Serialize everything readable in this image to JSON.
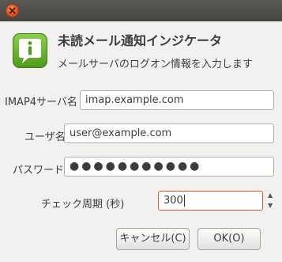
{
  "dialog": {
    "title": "未読メール通知インジケータ",
    "subtitle": "メールサーバのログオン情報を入力します"
  },
  "form": {
    "imap_server": {
      "label": "IMAP4サーバ名",
      "value": "imap.example.com"
    },
    "username": {
      "label": "ユーザ名",
      "value": "user@example.com"
    },
    "password": {
      "label": "パスワード",
      "masked": "●●●●●●●●●●●"
    },
    "check_interval": {
      "label": "チェック周期 (秒)",
      "value": "300"
    }
  },
  "buttons": {
    "cancel": "キャンセル(C)",
    "ok": "OK(O)"
  },
  "icons": {
    "close": "close-icon",
    "app": "info-speech-bubble-icon",
    "spin_up": "chevron-up-icon",
    "spin_down": "chevron-down-icon"
  },
  "colors": {
    "close_button": "#dd4814",
    "app_icon": "#6bb42e",
    "focus_border": "#e05a2b",
    "titlebar": "#4f4e4a"
  }
}
